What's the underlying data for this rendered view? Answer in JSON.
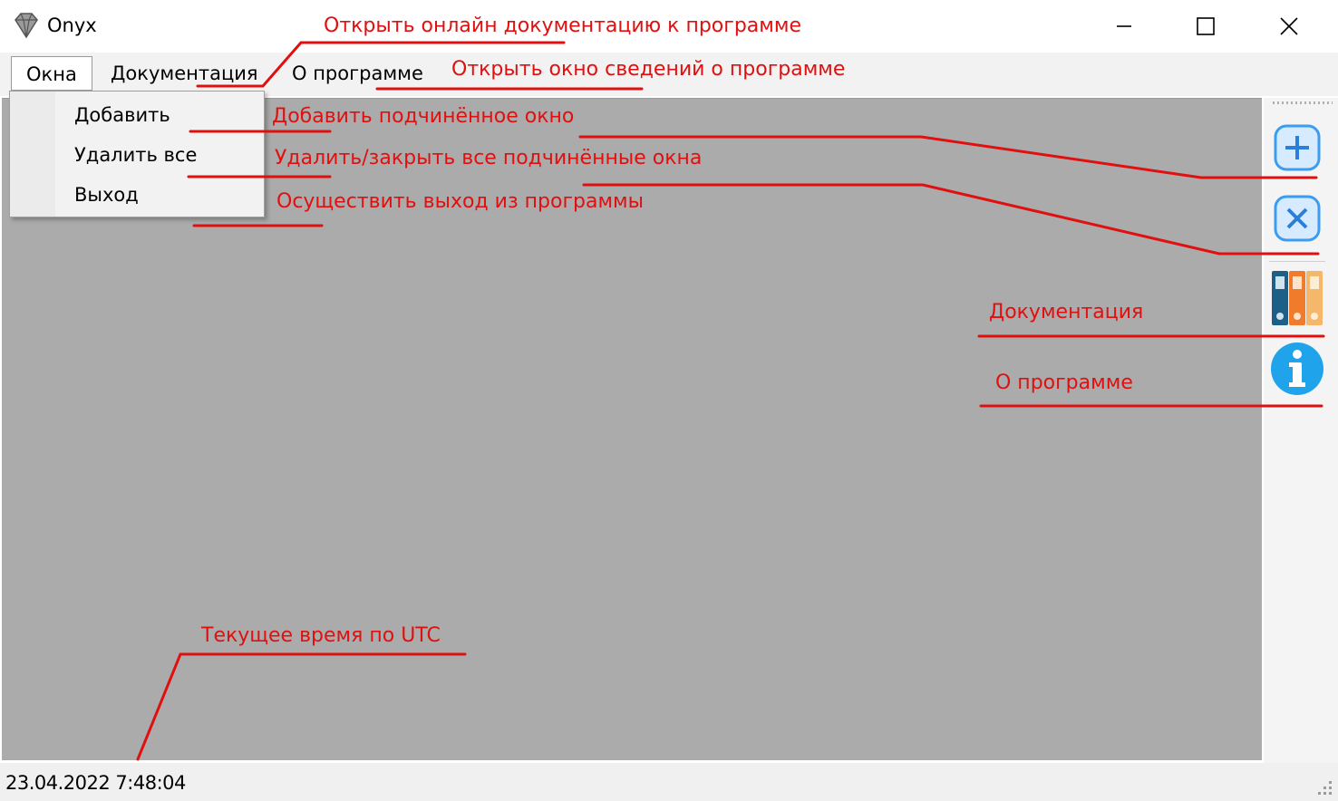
{
  "window": {
    "title": "Onyx",
    "controls": [
      "minimize",
      "maximize",
      "close"
    ]
  },
  "menu": {
    "items": [
      {
        "label": "Окна",
        "active": true
      },
      {
        "label": "Документация",
        "active": false
      },
      {
        "label": "О программе",
        "active": false
      }
    ]
  },
  "dropdown": {
    "items": [
      "Добавить",
      "Удалить все",
      "Выход"
    ]
  },
  "toolbar": {
    "buttons": [
      "plus-icon",
      "close-x-icon",
      "binders-icon",
      "info-icon"
    ]
  },
  "status": {
    "time": "23.04.2022 7:48:04"
  },
  "annotations": {
    "open_docs": "Открыть онлайн документацию к программе",
    "open_about": "Открыть окно сведений о программе",
    "add_child": "Добавить подчинённое окно",
    "remove_all": "Удалить/закрыть все подчинённые окна",
    "exit": "Осуществить выход из программы",
    "docs": "Документация",
    "about": "О программе",
    "utc_time": "Текущее время по UTC"
  },
  "colors": {
    "annotation": "#e01010",
    "workspace": "#ababab",
    "tool_blue": "#3b9cf0"
  }
}
